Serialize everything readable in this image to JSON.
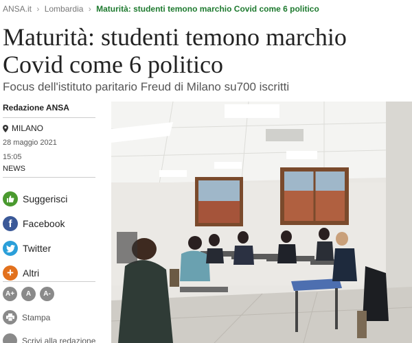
{
  "breadcrumb": {
    "home": "ANSA.it",
    "separator": "›",
    "section": "Lombardia",
    "current": "Maturità: studenti temono marchio Covid come 6 politico"
  },
  "article": {
    "title": "Maturità: studenti temono marchio Covid come 6 politico",
    "subtitle": "Focus dell'istituto paritario Freud di Milano su700 iscritti"
  },
  "meta": {
    "author": "Redazione ANSA",
    "location": "MILANO",
    "date": "28 maggio 2021",
    "time": "15:05",
    "section": "NEWS"
  },
  "share": {
    "suggest_label": "Suggerisci",
    "facebook_label": "Facebook",
    "twitter_label": "Twitter",
    "more_label": "Altri"
  },
  "font_size": {
    "increase_label": "A+",
    "normal_label": "A",
    "decrease_label": "A-"
  },
  "print_label": "Stampa",
  "write_label": "Scrivi alla redazione",
  "colors": {
    "suggest": "#4a9a2f",
    "facebook": "#3b5998",
    "twitter": "#2b9fd9",
    "more": "#e2711d",
    "breadcrumb_current": "#1e7a2f"
  },
  "icons": {
    "suggest": "thumbs-up-icon",
    "facebook": "facebook-icon",
    "twitter": "twitter-icon",
    "more": "plus-icon",
    "print": "printer-icon",
    "location": "map-pin-icon"
  }
}
